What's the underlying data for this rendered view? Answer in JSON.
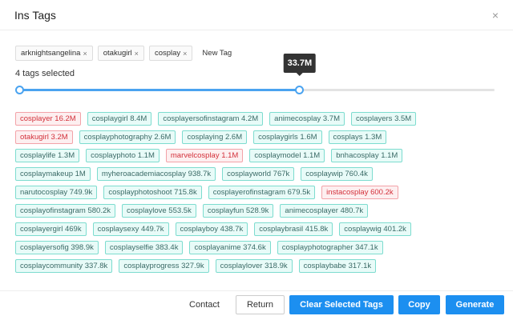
{
  "header": {
    "title": "Ins Tags",
    "close": "×"
  },
  "selected_tags": [
    {
      "label": "arknightsangelina"
    },
    {
      "label": "otakugirl"
    },
    {
      "label": "cosplay"
    }
  ],
  "remove_icon": "×",
  "new_tag_label": "New Tag",
  "count_text": "4 tags selected",
  "slider": {
    "value_label": "33.7M",
    "fraction": 0.59
  },
  "tag_rows": [
    [
      {
        "t": "cosplayer 16.2M",
        "on": true
      },
      {
        "t": "cosplaygirl 8.4M"
      },
      {
        "t": "cosplayersofinstagram 4.2M"
      },
      {
        "t": "animecosplay 3.7M"
      },
      {
        "t": "cosplayers 3.5M"
      }
    ],
    [
      {
        "t": "otakugirl 3.2M",
        "on": true
      },
      {
        "t": "cosplayphotography 2.6M"
      },
      {
        "t": "cosplaying 2.6M"
      },
      {
        "t": "cosplaygirls 1.6M"
      },
      {
        "t": "cosplays 1.3M"
      }
    ],
    [
      {
        "t": "cosplaylife 1.3M"
      },
      {
        "t": "cosplayphoto 1.1M"
      },
      {
        "t": "marvelcosplay 1.1M",
        "on": true
      },
      {
        "t": "cosplaymodel 1.1M"
      },
      {
        "t": "bnhacosplay 1.1M"
      }
    ],
    [
      {
        "t": "cosplaymakeup 1M"
      },
      {
        "t": "myheroacademiacosplay 938.7k"
      },
      {
        "t": "cosplayworld 767k"
      },
      {
        "t": "cosplaywip 760.4k"
      }
    ],
    [
      {
        "t": "narutocosplay 749.9k"
      },
      {
        "t": "cosplayphotoshoot 715.8k"
      },
      {
        "t": "cosplayerofinstagram 679.5k"
      },
      {
        "t": "instacosplay 600.2k",
        "on": true
      }
    ],
    [
      {
        "t": "cosplayofinstagram 580.2k"
      },
      {
        "t": "cosplaylove 553.5k"
      },
      {
        "t": "cosplayfun 528.9k"
      },
      {
        "t": "animecosplayer 480.7k"
      }
    ],
    [
      {
        "t": "cosplayergirl 469k"
      },
      {
        "t": "cosplaysexy 449.7k"
      },
      {
        "t": "cosplayboy 438.7k"
      },
      {
        "t": "cosplaybrasil 415.8k"
      },
      {
        "t": "cosplaywig 401.2k"
      }
    ],
    [
      {
        "t": "cosplayersofig 398.9k"
      },
      {
        "t": "cosplayselfie 383.4k"
      },
      {
        "t": "cosplayanime 374.6k"
      },
      {
        "t": "cosplayphotographer 347.1k"
      }
    ],
    [
      {
        "t": "cosplaycommunity 337.8k"
      },
      {
        "t": "cosplayprogress 327.9k"
      },
      {
        "t": "cosplaylover 318.9k"
      },
      {
        "t": "cosplaybabe 317.1k"
      }
    ]
  ],
  "footer": {
    "contact": "Contact",
    "return": "Return",
    "clear": "Clear Selected Tags",
    "copy": "Copy",
    "generate": "Generate"
  },
  "colors": {
    "accent": "#1c8ff0",
    "selected": "#d3303a",
    "tag": "#7ddccf"
  }
}
